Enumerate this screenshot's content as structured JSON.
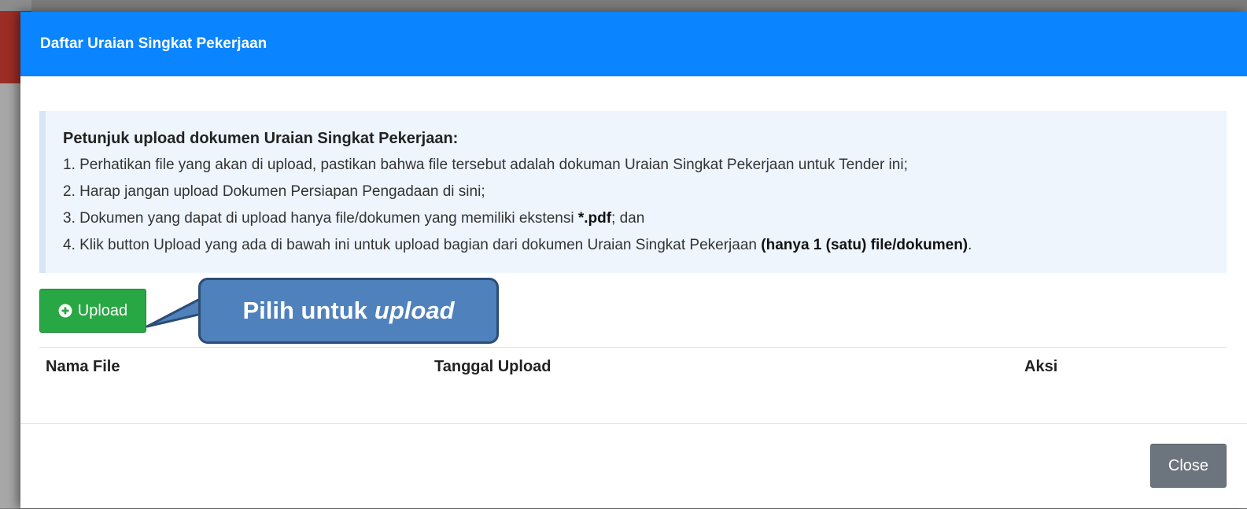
{
  "modal": {
    "title": "Daftar Uraian Singkat Pekerjaan"
  },
  "instructions": {
    "heading": "Petunjuk upload dokumen Uraian Singkat Pekerjaan:",
    "item1": "1. Perhatikan file yang akan di upload, pastikan bahwa file tersebut adalah dokuman Uraian Singkat Pekerjaan untuk Tender ini;",
    "item2": "2. Harap jangan upload Dokumen Persiapan Pengadaan di sini;",
    "item3_prefix": "3. Dokumen yang dapat di upload hanya file/dokumen yang memiliki ekstensi ",
    "item3_ext": "*.pdf",
    "item3_suffix": "; dan",
    "item4_prefix": "4. Klik button Upload yang ada di bawah ini untuk upload bagian dari dokumen Uraian Singkat Pekerjaan ",
    "item4_bold": "(hanya 1 (satu) file/dokumen)",
    "item4_suffix": "."
  },
  "upload_button": {
    "label": "Upload",
    "icon": "plus-circle-icon"
  },
  "annotation": {
    "prefix": "Pilih untuk",
    "emphasis": "upload"
  },
  "table": {
    "columns": [
      "Nama File",
      "Tanggal Upload",
      "Aksi"
    ],
    "rows": []
  },
  "footer": {
    "close_label": "Close"
  },
  "colors": {
    "header": "#0a84ff",
    "upload": "#28a745",
    "close": "#6c757d",
    "callout": "#eef5fd",
    "annotation": "#4f81bd"
  }
}
